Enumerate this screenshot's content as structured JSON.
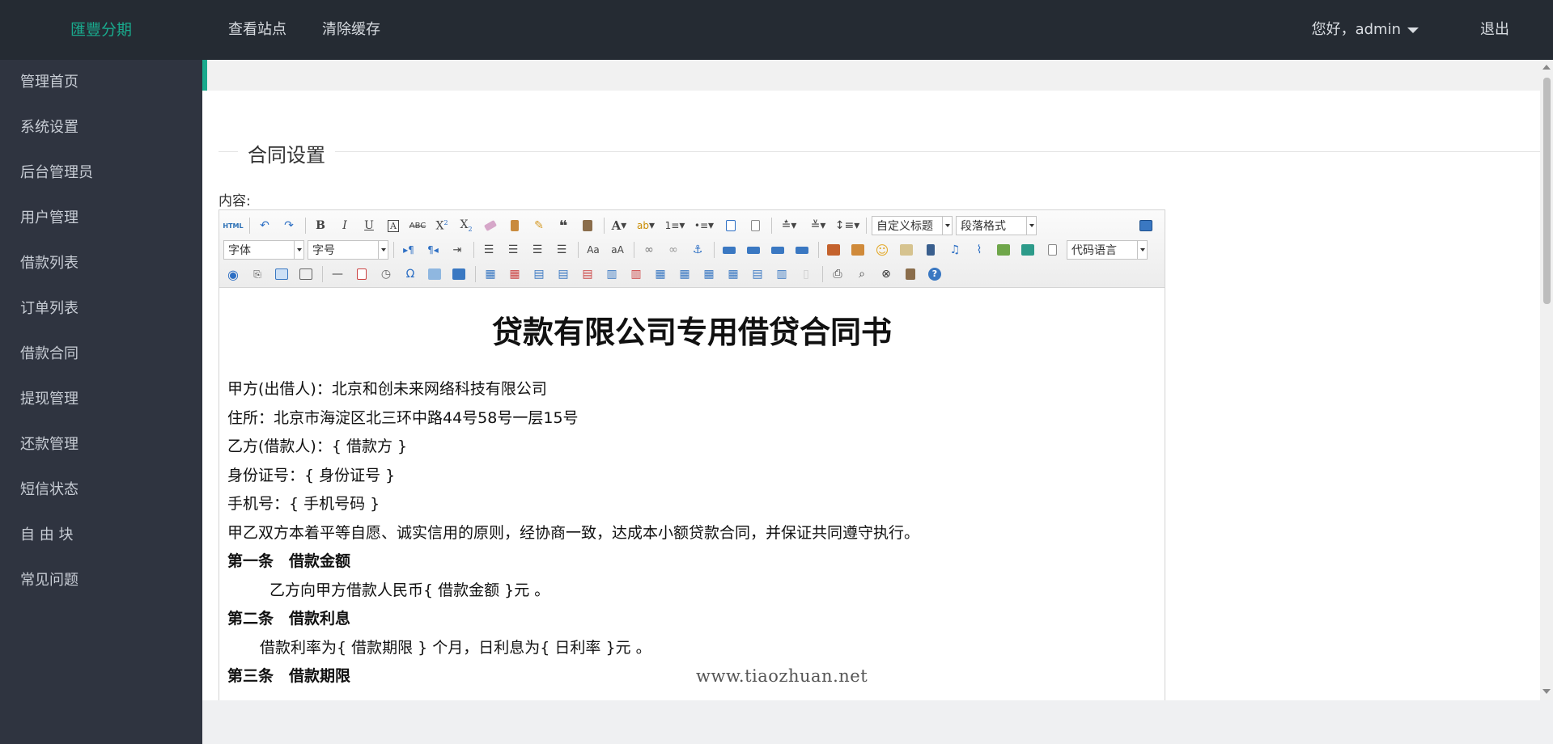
{
  "header": {
    "brand": "匯豐分期",
    "nav": [
      "查看站点",
      "清除缓存"
    ],
    "greeting": "您好，admin",
    "logout": "退出"
  },
  "sidebar": {
    "items": [
      "管理首页",
      "系统设置",
      "后台管理员",
      "用户管理",
      "借款列表",
      "订单列表",
      "借款合同",
      "提现管理",
      "还款管理",
      "短信状态",
      "自 由 块",
      "常见问题"
    ]
  },
  "main": {
    "section_title": "合同设置",
    "content_label": "内容:"
  },
  "toolbar": {
    "html_btn": "HTML",
    "custom_title": "自定义标题",
    "paragraph_format": "段落格式",
    "font_family": "字体",
    "font_size": "字号",
    "code_language": "代码语言"
  },
  "document": {
    "title": "贷款有限公司专用借贷合同书",
    "lines": [
      "甲方(出借人)：北京和创未来网络科技有限公司",
      "住所：北京市海淀区北三环中路44号58号一层15号",
      "乙方(借款人)：{ 借款方 }",
      "身份证号：{ 身份证号 }",
      "手机号：{ 手机号码 }",
      "甲乙双方本着平等自愿、诚实信用的原则，经协商一致，达成本小额贷款合同，并保证共同遵守执行。"
    ],
    "clause1_title": "第一条　借款金额",
    "clause1_text": "乙方向甲方借款人民币{ 借款金额 }元 。",
    "clause2_title": "第二条　借款利息",
    "clause2_text": "借款利率为{ 借款期限 } 个月，日利息为{ 日利率 }元 。",
    "clause3_title": "第三条　借款期限"
  },
  "watermark": "www.tiaozhuan.net"
}
